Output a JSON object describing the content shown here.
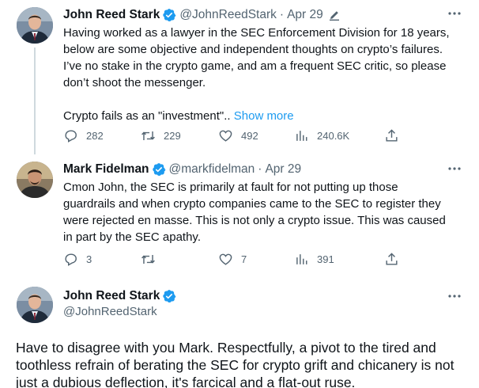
{
  "tweets": [
    {
      "author_name": "John Reed Stark",
      "handle": "@JohnReedStark",
      "separator": "·",
      "date": "Apr 29",
      "text_lines": [
        "Having worked as a lawyer in the SEC Enforcement Division for 18 years,",
        "below are some objective and independent thoughts on crypto’s failures.",
        "I’ve no stake in the crypto game, and am a frequent SEC critic, so please",
        "don’t shoot the messenger."
      ],
      "text_tail": "Crypto fails as an \"investment\"..",
      "show_more": "Show more",
      "replies": "282",
      "retweets": "229",
      "likes": "492",
      "views": "240.6K"
    },
    {
      "author_name": "Mark Fidelman",
      "handle": "@markfidelman",
      "separator": "·",
      "date": "Apr 29",
      "text_lines": [
        "Cmon John, the SEC is primarily at fault for not putting up those",
        "guardrails and when crypto companies came to the SEC to register they",
        "were rejected en masse. This is not only a crypto issue. This was caused",
        "in part by the SEC apathy."
      ],
      "replies": "3",
      "retweets": "",
      "likes": "7",
      "views": "391"
    }
  ],
  "main_tweet": {
    "author_name": "John Reed Stark",
    "handle": "@JohnReedStark",
    "text_lines": [
      "Have to disagree with you Mark. Respectfully, a pivot to the tired and",
      "toothless refrain of berating the SEC for crypto grift and chicanery is not",
      "just a dubious deflection, it's farcical and a flat-out ruse."
    ]
  },
  "colors": {
    "verified": "#1d9bf0",
    "link": "#1d9bf0",
    "muted": "#536471",
    "thread_line": "#cfd9de"
  },
  "icons": {
    "reply": "reply-icon",
    "retweet": "retweet-icon",
    "like": "heart-icon",
    "views": "views-chart-icon",
    "share": "share-icon",
    "more": "more-icon",
    "verified": "verified-badge-icon",
    "edited": "edited-pencil-icon"
  }
}
